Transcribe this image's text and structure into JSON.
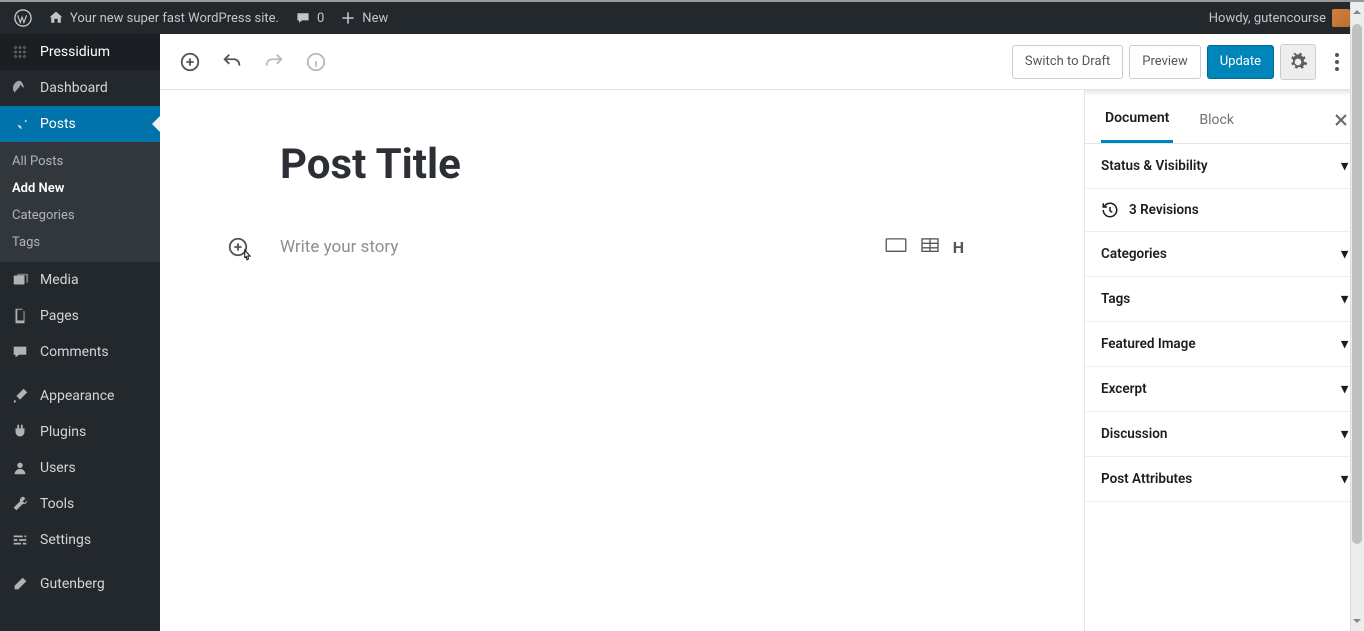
{
  "adminbar": {
    "site_title": "Your new super fast WordPress site.",
    "comments_count": "0",
    "new_label": "New",
    "howdy_prefix": "Howdy, ",
    "username": "gutencourse"
  },
  "adminmenu": {
    "host": "Pressidium",
    "items": [
      {
        "label": "Dashboard",
        "icon": "dashboard"
      },
      {
        "label": "Posts",
        "icon": "pin",
        "current": true,
        "submenu": [
          {
            "label": "All Posts"
          },
          {
            "label": "Add New",
            "current": true
          },
          {
            "label": "Categories"
          },
          {
            "label": "Tags"
          }
        ]
      },
      {
        "label": "Media",
        "icon": "media"
      },
      {
        "label": "Pages",
        "icon": "pages"
      },
      {
        "label": "Comments",
        "icon": "comments"
      },
      {
        "label": "Appearance",
        "icon": "brush",
        "sep_before": true
      },
      {
        "label": "Plugins",
        "icon": "plug"
      },
      {
        "label": "Users",
        "icon": "user"
      },
      {
        "label": "Tools",
        "icon": "wrench"
      },
      {
        "label": "Settings",
        "icon": "sliders"
      },
      {
        "label": "Gutenberg",
        "icon": "edit",
        "sep_before": true
      }
    ]
  },
  "editbar": {
    "switch_draft": "Switch to Draft",
    "preview": "Preview",
    "update": "Update"
  },
  "editor": {
    "title": "Post Title",
    "placeholder": "Write your story"
  },
  "settings": {
    "tabs": {
      "document": "Document",
      "block": "Block"
    },
    "revisions_count": "3 Revisions",
    "panels": [
      "Status & Visibility",
      "Categories",
      "Tags",
      "Featured Image",
      "Excerpt",
      "Discussion",
      "Post Attributes"
    ]
  }
}
